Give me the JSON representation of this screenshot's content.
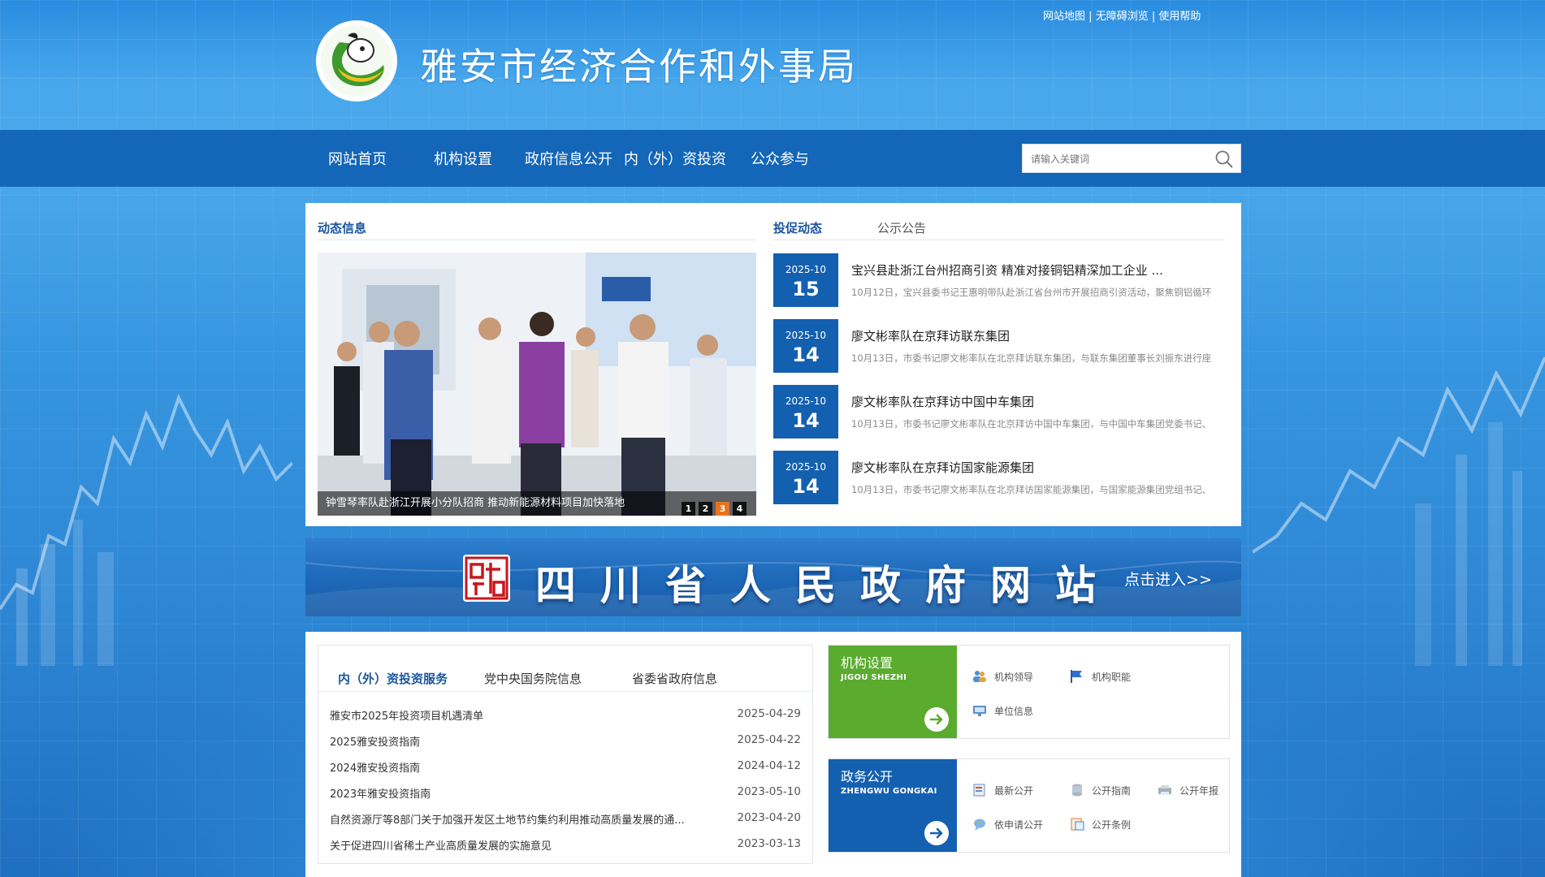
{
  "header": {
    "top_links": [
      "网站地图",
      "无障碍浏览",
      "使用帮助"
    ],
    "separator": "|",
    "site_title": "雅安市经济合作和外事局"
  },
  "nav": {
    "items": [
      "网站首页",
      "机构设置",
      "政府信息公开",
      "内（外）资投资",
      "公众参与"
    ],
    "search_placeholder": "请输入关键词"
  },
  "news": {
    "left_title": "动态信息",
    "right_tabs": [
      "投促动态",
      "公示公告"
    ],
    "slide_caption": "钟雪琴率队赴浙江开展小分队招商 推动新能源材料项目加快落地",
    "slide_dots": [
      "1",
      "2",
      "3",
      "4"
    ],
    "slide_active": 3,
    "items": [
      {
        "ym": "2025-10",
        "d": "15",
        "title": "宝兴县赴浙江台州招商引资  精准对接铜铝精深加工企业 ...",
        "summary": "10月12日，宝兴县委书记王惠明带队赴浙江省台州市开展招商引资活动，聚焦铜铝循环"
      },
      {
        "ym": "2025-10",
        "d": "14",
        "title": "廖文彬率队在京拜访联东集团",
        "summary": "10月13日，市委书记廖文彬率队在北京拜访联东集团，与联东集团董事长刘振东进行座"
      },
      {
        "ym": "2025-10",
        "d": "14",
        "title": "廖文彬率队在京拜访中国中车集团",
        "summary": "10月13日，市委书记廖文彬率队在北京拜访中国中车集团，与中国中车集团党委书记、"
      },
      {
        "ym": "2025-10",
        "d": "14",
        "title": "廖文彬率队在京拜访国家能源集团",
        "summary": "10月13日，市委书记廖文彬率队在北京拜访国家能源集团，与国家能源集团党组书记、"
      }
    ]
  },
  "banner": {
    "text": "四川省人民政府网站",
    "enter": "点击进入>>"
  },
  "list_panel": {
    "tabs": [
      "内（外）资投资服务",
      "党中央国务院信息",
      "省委省政府信息"
    ],
    "rows": [
      {
        "title": "雅安市2025年投资项目机遇清单",
        "date": "2025-04-29"
      },
      {
        "title": "2025雅安投资指南",
        "date": "2025-04-22"
      },
      {
        "title": "2024雅安投资指南",
        "date": "2024-04-12"
      },
      {
        "title": "2023年雅安投资指南",
        "date": "2023-05-10"
      },
      {
        "title": "自然资源厅等8部门关于加强开发区土地节约集约利用推动高质量发展的通...",
        "date": "2023-04-20"
      },
      {
        "title": "关于促进四川省稀土产业高质量发展的实施意见",
        "date": "2023-03-13"
      }
    ]
  },
  "services": [
    {
      "title": "机构设置",
      "sub": "JIGOU SHEZHI",
      "color": "#5aab2e",
      "links": [
        "机构领导",
        "机构职能",
        "单位信息"
      ]
    },
    {
      "title": "政务公开",
      "sub": "ZHENGWU GONGKAI",
      "color": "#1460b0",
      "links": [
        "最新公开",
        "公开指南",
        "公开年报",
        "依申请公开",
        "公开条例"
      ]
    }
  ],
  "colors": {
    "nav_bg": "#1366b8",
    "date_box": "#1460b0",
    "accent_orange": "#e8731d",
    "green": "#5aab2e"
  }
}
